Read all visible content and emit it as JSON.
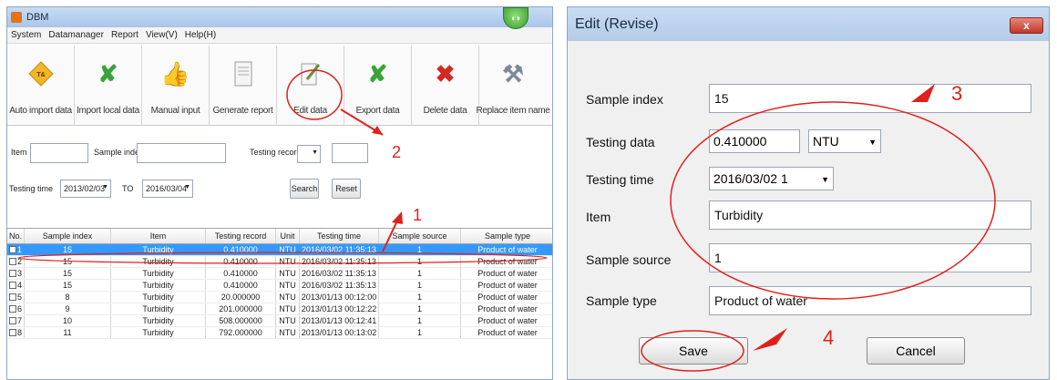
{
  "left_window": {
    "title": "DBM",
    "menu": [
      "System",
      "Datamanager",
      "Report",
      "View(V)",
      "Help(H)"
    ],
    "toolbar": [
      {
        "label": "Auto import data",
        "icon": "diamond-import-icon",
        "color": "#e8a21c"
      },
      {
        "label": "Import local data",
        "icon": "green-x-icon",
        "color": "#3aa33a"
      },
      {
        "label": "Manual input",
        "icon": "thumb-up-icon",
        "color": "#c9a23a"
      },
      {
        "label": "Generate report",
        "icon": "report-doc-icon",
        "color": "#8a8a8a"
      },
      {
        "label": "Edit data",
        "icon": "edit-doc-icon",
        "color": "#6b8e3a"
      },
      {
        "label": "Export data",
        "icon": "green-x-export-icon",
        "color": "#3aa33a"
      },
      {
        "label": "Delete data",
        "icon": "red-x-icon",
        "color": "#d22a22"
      },
      {
        "label": "Replace item name",
        "icon": "tools-icon",
        "color": "#7a8a9a"
      }
    ],
    "filters": {
      "item_label": "Item",
      "sample_index_label": "Sample index",
      "testing_record_label": "Testing record",
      "testing_time_label": "Testing time",
      "date_from": "2013/02/03",
      "to_label": "TO",
      "date_to": "2016/03/04",
      "search_label": "Search",
      "reset_label": "Reset"
    },
    "columns": [
      "No.",
      "Sample index",
      "Item",
      "Testing record",
      "Unit",
      "Testing time",
      "Sample source",
      "Sample type"
    ],
    "rows": [
      [
        "1",
        "15",
        "Turbidity",
        "0.410000",
        "NTU",
        "2016/03/02 11:35:13",
        "1",
        "Product of water"
      ],
      [
        "2",
        "15",
        "Turbidity",
        "0.410000",
        "NTU",
        "2016/03/02 11:35:13",
        "1",
        "Product of water"
      ],
      [
        "3",
        "15",
        "Turbidity",
        "0.410000",
        "NTU",
        "2016/03/02 11:35:13",
        "1",
        "Product of water"
      ],
      [
        "4",
        "15",
        "Turbidity",
        "0.410000",
        "NTU",
        "2016/03/02 11:35:13",
        "1",
        "Product of water"
      ],
      [
        "5",
        "8",
        "Turbidity",
        "20.000000",
        "NTU",
        "2013/01/13 00:12:00",
        "1",
        "Product of water"
      ],
      [
        "6",
        "9",
        "Turbidity",
        "201.000000",
        "NTU",
        "2013/01/13 00:12:22",
        "1",
        "Product of water"
      ],
      [
        "7",
        "10",
        "Turbidity",
        "508.000000",
        "NTU",
        "2013/01/13 00:12:41",
        "1",
        "Product of water"
      ],
      [
        "8",
        "11",
        "Turbidity",
        "792.000000",
        "NTU",
        "2013/01/13 00:13:02",
        "1",
        "Product of water"
      ]
    ],
    "selected_row": 0
  },
  "dialog": {
    "title": "Edit (Revise)",
    "close_glyph": "x",
    "fields": {
      "sample_index": {
        "label": "Sample index",
        "value": "15"
      },
      "testing_data": {
        "label": "Testing data",
        "value": "0.410000",
        "unit": "NTU"
      },
      "testing_time": {
        "label": "Testing time",
        "value": "2016/03/02 1"
      },
      "item": {
        "label": "Item",
        "value": "Turbidity"
      },
      "sample_source": {
        "label": "Sample source",
        "value": "1"
      },
      "sample_type": {
        "label": "Sample type",
        "value": "Product of water"
      }
    },
    "save_label": "Save",
    "cancel_label": "Cancel"
  },
  "annotations": {
    "step1": "1",
    "step2": "2",
    "step3": "3",
    "step4": "4",
    "color": "#e0201a"
  }
}
